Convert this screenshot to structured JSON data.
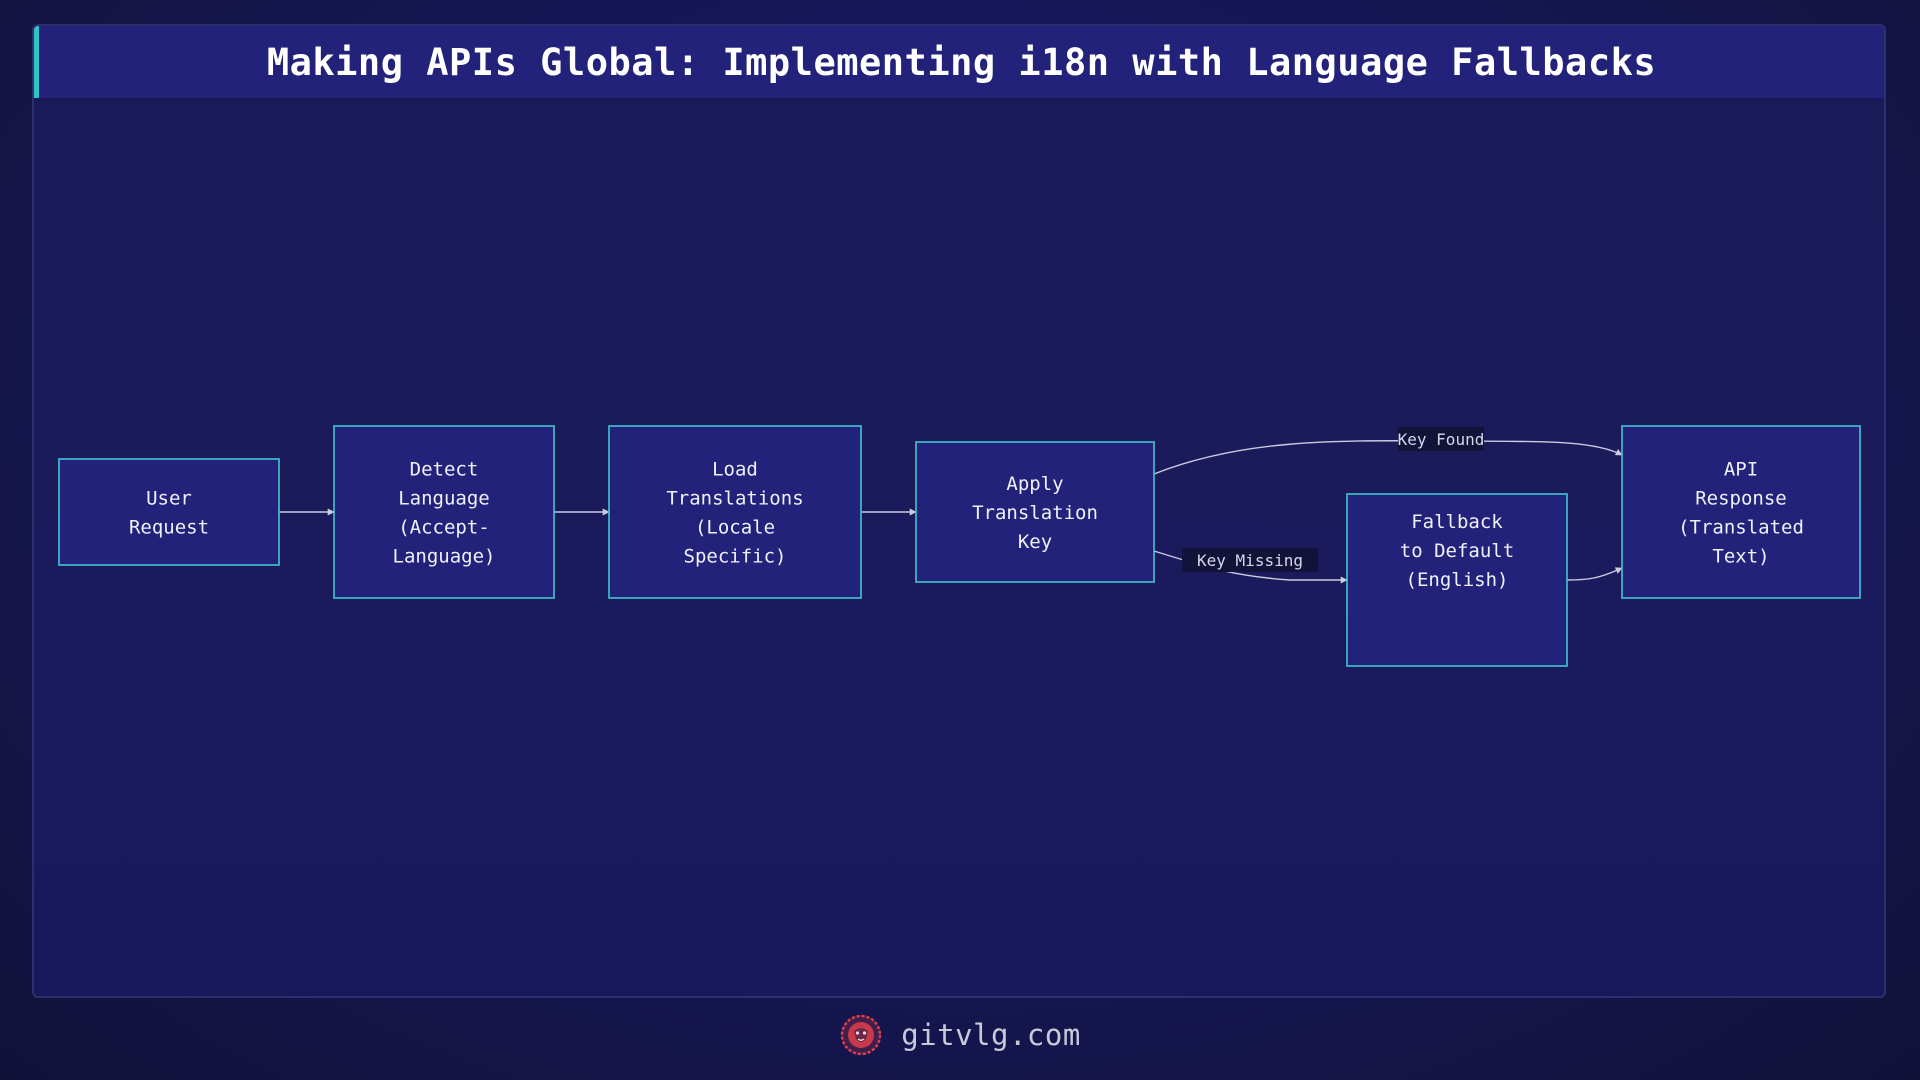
{
  "title": "Making APIs Global: Implementing i18n with Language Fallbacks",
  "colors": {
    "background": "#17175a",
    "title_bar": "#23227a",
    "title_accent": "#2ec4c4",
    "node_fill": "#23227a",
    "node_border": "#3fc6d0",
    "edge": "#c9cbe0",
    "edge_label_bg": "#131238",
    "logo": "#e0404a"
  },
  "nodes": [
    {
      "id": "user-request",
      "lines": [
        "User",
        "Request"
      ]
    },
    {
      "id": "detect-language",
      "lines": [
        "Detect",
        "Language",
        "(Accept-",
        "Language)"
      ]
    },
    {
      "id": "load-translations",
      "lines": [
        "Load",
        "Translations",
        "(Locale",
        "Specific)"
      ]
    },
    {
      "id": "apply-translation-key",
      "lines": [
        "Apply",
        "Translation",
        "Key"
      ]
    },
    {
      "id": "fallback-default",
      "lines": [
        "Fallback",
        "to Default",
        "(English)"
      ]
    },
    {
      "id": "api-response",
      "lines": [
        "API",
        "Response",
        "(Translated",
        "Text)"
      ]
    }
  ],
  "edges": [
    {
      "from": "user-request",
      "to": "detect-language",
      "label": ""
    },
    {
      "from": "detect-language",
      "to": "load-translations",
      "label": ""
    },
    {
      "from": "load-translations",
      "to": "apply-translation-key",
      "label": ""
    },
    {
      "from": "apply-translation-key",
      "to": "api-response",
      "label": "Key Found"
    },
    {
      "from": "apply-translation-key",
      "to": "fallback-default",
      "label": "Key Missing"
    },
    {
      "from": "fallback-default",
      "to": "api-response",
      "label": ""
    }
  ],
  "footer": {
    "site": "gitvlg.com",
    "logo_icon": "lion-head-icon"
  }
}
